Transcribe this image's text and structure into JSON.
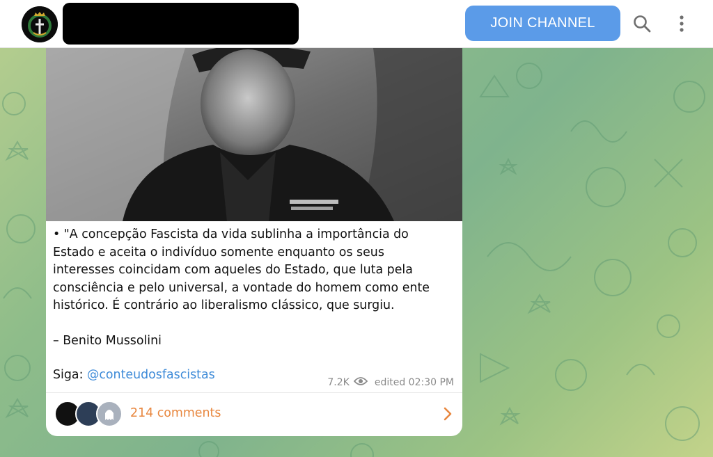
{
  "header": {
    "channel_avatar_icon": "coat-of-arms-icon",
    "channel_name_redacted": true,
    "join_label": "JOIN CHANNEL",
    "search_icon": "search-icon",
    "more_icon": "more-vertical-icon",
    "accent_color": "#5b9be8"
  },
  "post": {
    "photo_description_icon": "photo",
    "text_lines": "• \"A concepção Fascista da vida sublinha a importância do\nEstado e aceita o indivíduo somente enquanto os seus\ninteresses coincidam com aqueles do Estado, que luta pela\nconsciência e pelo universal, a vontade do homem como ente\nhistórico. É contrário ao liberalismo clássico, que surgiu.",
    "author": "– Benito Mussolini",
    "follow_prefix": "Siga: ",
    "follow_handle": "@conteudosfascistas",
    "views": "7.2K",
    "edited": "edited 02:30 PM",
    "link_color": "#3e8bd8"
  },
  "comments": {
    "count_label": "214 comments",
    "color": "#e8873f"
  }
}
